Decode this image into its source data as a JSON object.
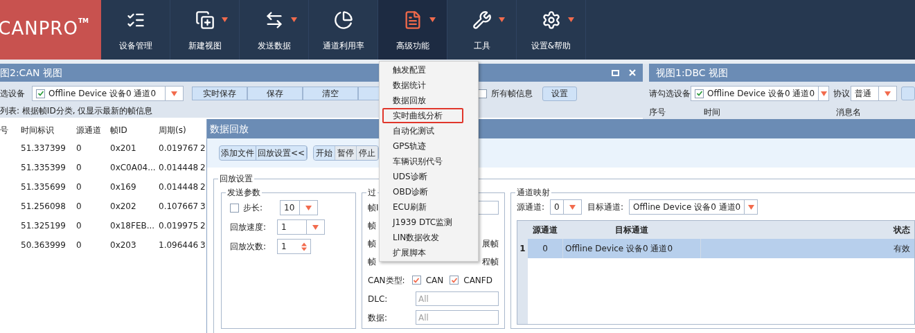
{
  "logo": {
    "text": "CANPRO",
    "mark": "TM"
  },
  "toolbar": [
    {
      "label": "设备管理",
      "selected": false,
      "has_menu": false
    },
    {
      "label": "新建视图",
      "selected": false,
      "has_menu": true
    },
    {
      "label": "发送数据",
      "selected": false,
      "has_menu": true
    },
    {
      "label": "通道利用率",
      "selected": false,
      "has_menu": false
    },
    {
      "label": "高级功能",
      "selected": true,
      "has_menu": true
    },
    {
      "label": "工具",
      "selected": false,
      "has_menu": true
    },
    {
      "label": "设置&帮助",
      "selected": false,
      "has_menu": true
    }
  ],
  "can_view": {
    "title": "图2:CAN 视图",
    "device_label": "选设备",
    "device": {
      "checked": true,
      "value": "Offline Device 设备0 通道0"
    },
    "buttons": [
      "实时保存",
      "保存",
      "清空"
    ],
    "all_frames": {
      "label": "所有帧信息",
      "checked": false
    },
    "settings_button": "设置",
    "info": "列表: 根据帧ID分类, 仅显示最新的帧信息",
    "columns": [
      "号",
      "时间标识",
      "源通道",
      "帧ID",
      "周期(s)"
    ],
    "rows": [
      [
        "",
        "51.337399",
        "0",
        "0x201",
        "0.019767",
        "2"
      ],
      [
        "",
        "51.335399",
        "0",
        "0xC0A04...",
        "0.014448",
        "2"
      ],
      [
        "",
        "51.335699",
        "0",
        "0x169",
        "0.014448",
        "2"
      ],
      [
        "",
        "51.256098",
        "0",
        "0x202",
        "0.107667",
        "3"
      ],
      [
        "",
        "51.325199",
        "0",
        "0x18FEB...",
        "0.019975",
        "2"
      ],
      [
        "",
        "50.363999",
        "0",
        "0x203",
        "1.096446",
        "3"
      ]
    ]
  },
  "dbc_view": {
    "title": "视图1:DBC 视图",
    "device_label": "请勾选设备",
    "device": {
      "checked": true,
      "value": "Offline Device 设备0 通道0"
    },
    "protocol_label": "协议",
    "protocol": "普通",
    "columns": [
      "序号",
      "时间",
      "消息名"
    ]
  },
  "playback_dialog": {
    "title": "数据回放",
    "file_buttons": [
      "添加文件",
      "回放设置<<"
    ],
    "control_buttons": [
      "开始",
      "暂停",
      "停止"
    ],
    "settings_group": "回放设置",
    "send_params": {
      "title": "发送参数",
      "step": {
        "label": "步长:",
        "checked": false,
        "value": "10"
      },
      "speed": {
        "label": "回放速度:",
        "value": "1"
      },
      "count": {
        "label": "回放次数:",
        "value": "1"
      }
    },
    "filter": {
      "title": "过",
      "rows": [
        {
          "label": "帧I",
          "right": ""
        },
        {
          "label": "帧",
          "right": ""
        },
        {
          "label": "帧",
          "right": "展帧"
        },
        {
          "label": "帧",
          "right": "程帧"
        }
      ],
      "can_type": {
        "label": "CAN类型:",
        "options": [
          {
            "label": "CAN",
            "checked": true
          },
          {
            "label": "CANFD",
            "checked": true
          }
        ]
      },
      "dlc": {
        "label": "DLC:",
        "placeholder": "All"
      },
      "data": {
        "label": "数据:",
        "placeholder": "All"
      }
    },
    "mapping": {
      "title": "通道映射",
      "source_label": "源通道:",
      "source": "0",
      "target_label": "目标通道:",
      "target": "Offline Device 设备0 通道0",
      "columns": [
        "源通道",
        "目标通道",
        "状态"
      ],
      "rows": [
        {
          "index": "1",
          "source": "0",
          "target": "Offline Device 设备0 通道0",
          "status": "有效",
          "selected": true
        }
      ]
    }
  },
  "advanced_menu": [
    {
      "label": "触发配置",
      "highlighted": false
    },
    {
      "label": "数据统计",
      "highlighted": false
    },
    {
      "label": "数据回放",
      "highlighted": false
    },
    {
      "label": "实时曲线分析",
      "highlighted": true
    },
    {
      "label": "自动化测试",
      "highlighted": false
    },
    {
      "label": "GPS轨迹",
      "highlighted": false
    },
    {
      "label": "车辆识别代号",
      "highlighted": false
    },
    {
      "label": "UDS诊断",
      "highlighted": false
    },
    {
      "label": "OBD诊断",
      "highlighted": false
    },
    {
      "label": "ECU刷新",
      "highlighted": false
    },
    {
      "label": "J1939 DTC监测",
      "highlighted": false
    },
    {
      "label": "LIN数据收发",
      "highlighted": false
    },
    {
      "label": "扩展脚本",
      "highlighted": false
    }
  ]
}
